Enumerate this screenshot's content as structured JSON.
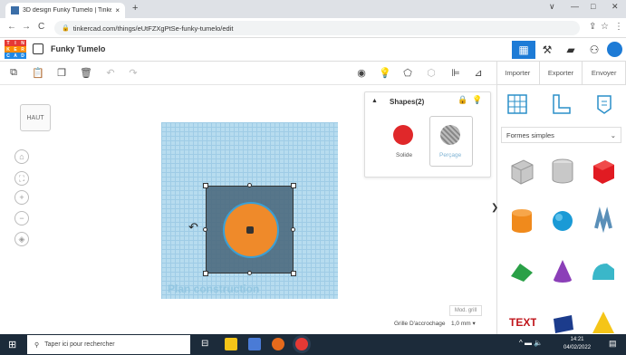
{
  "browser": {
    "tab_title": "3D design Funky Tumelo | Tinker",
    "tab_close": "×",
    "new_tab": "+",
    "url": "tinkercad.com/things/eUtFZXgPtSe-funky-tumelo/edit",
    "nav_back": "←",
    "nav_forward": "→",
    "nav_reload": "C"
  },
  "app": {
    "logo_letters": [
      "T",
      "I",
      "N",
      "K",
      "E",
      "R",
      "C",
      "A",
      "D"
    ],
    "logo_colors": [
      "#e53935",
      "#e53935",
      "#e53935",
      "#fb8c00",
      "#fb8c00",
      "#fb8c00",
      "#1e88e5",
      "#1e88e5",
      "#1e88e5"
    ],
    "project_name": "Funky Tumelo"
  },
  "right_panel": {
    "tabs": [
      "Importer",
      "Exporter",
      "Envoyer"
    ],
    "category": "Formes simples"
  },
  "workplane": {
    "view_cube_label": "HAUT",
    "label": "Plan construction"
  },
  "inspector": {
    "title": "Shapes(2)",
    "solid_label": "Solide",
    "hole_label": "Perçage"
  },
  "bottom": {
    "mod_grid": "Mod. grill",
    "snap_label": "Grille D'accrochage",
    "snap_value": "1,0 mm"
  },
  "taskbar": {
    "search_placeholder": "Taper ici pour rechercher",
    "time": "14:21",
    "date": "04/02/2022"
  }
}
